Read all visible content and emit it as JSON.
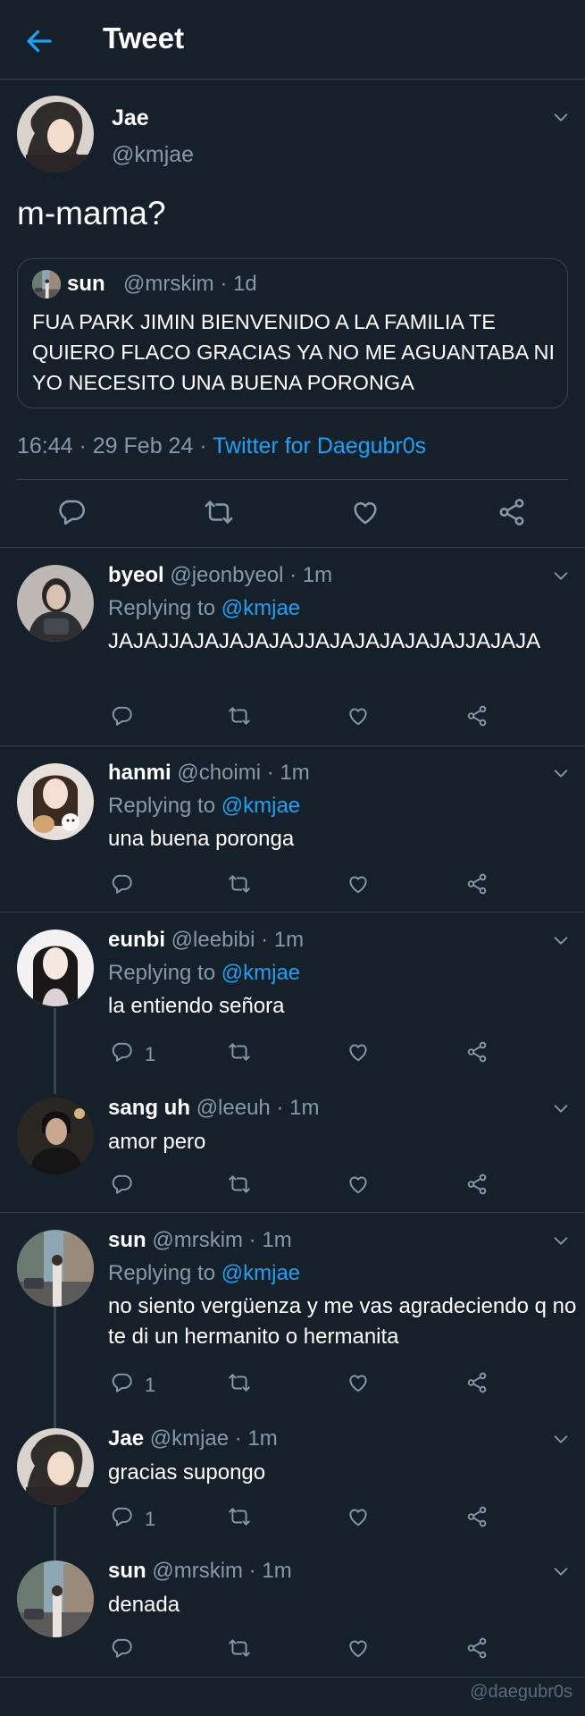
{
  "header": {
    "title": "Tweet"
  },
  "main_tweet": {
    "name": "Jae",
    "handle": "@kmjae",
    "text": "m-mama?",
    "quote": {
      "name": "sun",
      "meta": "@mrskim · 1d",
      "text": "FUA PARK JIMIN BIENVENIDO A LA FAMILIA TE QUIERO FLACO GRACIAS YA NO ME AGUANTABA NI YO NECESITO UNA BUENA PORONGA"
    },
    "time": "16:44 · 29 Feb 24 · ",
    "client": "Twitter for Daegubr0s"
  },
  "replies": [
    {
      "name": "byeol",
      "meta": "@jeonbyeol · 1m",
      "replying_label": "Replying to ",
      "replying_handle": "@kmjae",
      "text": "JAJAJJAJAJAJAJAJJAJAJAJAJAJAJJAJAJA",
      "reply_count": ""
    },
    {
      "name": "hanmi",
      "meta": "@choimi · 1m",
      "replying_label": "Replying to ",
      "replying_handle": "@kmjae",
      "text": "una buena poronga",
      "reply_count": ""
    },
    {
      "name": "eunbi",
      "meta": "@leebibi · 1m",
      "replying_label": "Replying to ",
      "replying_handle": "@kmjae",
      "text": "la entiendo señora",
      "reply_count": "1"
    },
    {
      "name": "sang uh",
      "meta": "@leeuh · 1m",
      "text": "amor pero",
      "reply_count": ""
    },
    {
      "name": "sun",
      "meta": "@mrskim · 1m",
      "replying_label": "Replying to ",
      "replying_handle": "@kmjae",
      "text": "no siento vergüenza y me vas agradeciendo q no te di un hermanito o hermanita",
      "reply_count": "1"
    },
    {
      "name": "Jae",
      "meta": "@kmjae · 1m",
      "text": "gracias supongo",
      "reply_count": "1"
    },
    {
      "name": "sun",
      "meta": "@mrskim · 1m",
      "text": "denada",
      "reply_count": ""
    }
  ],
  "watermark": "@daegubr0s",
  "colors": {
    "background": "#15202b",
    "accent": "#1da1f2",
    "muted": "#8899a6",
    "divider": "#38444d"
  },
  "icons": [
    "back-arrow-icon",
    "chevron-down-icon",
    "reply-icon",
    "retweet-icon",
    "like-icon",
    "share-icon"
  ]
}
